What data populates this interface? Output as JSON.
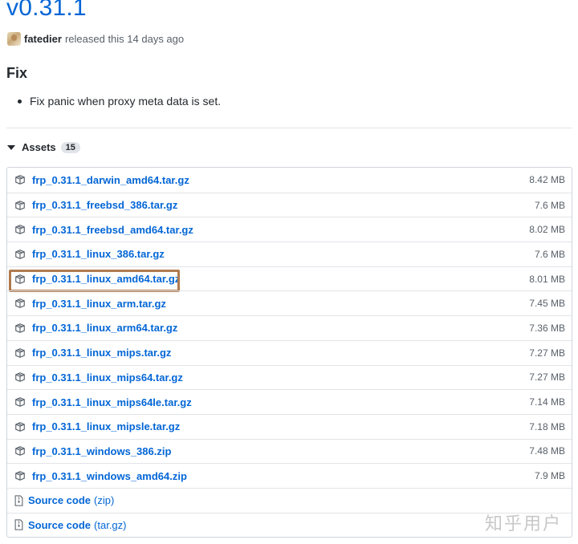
{
  "release": {
    "version": "v0.31.1",
    "author": "fatedier",
    "released_text": "released this 14 days ago"
  },
  "notes": {
    "heading": "Fix",
    "items": [
      "Fix panic when proxy meta data is set."
    ]
  },
  "assets": {
    "label": "Assets",
    "count": "15",
    "files": [
      {
        "name": "frp_0.31.1_darwin_amd64.tar.gz",
        "size": "8.42 MB"
      },
      {
        "name": "frp_0.31.1_freebsd_386.tar.gz",
        "size": "7.6 MB"
      },
      {
        "name": "frp_0.31.1_freebsd_amd64.tar.gz",
        "size": "8.02 MB"
      },
      {
        "name": "frp_0.31.1_linux_386.tar.gz",
        "size": "7.6 MB"
      },
      {
        "name": "frp_0.31.1_linux_amd64.tar.gz",
        "size": "8.01 MB",
        "highlighted": true
      },
      {
        "name": "frp_0.31.1_linux_arm.tar.gz",
        "size": "7.45 MB"
      },
      {
        "name": "frp_0.31.1_linux_arm64.tar.gz",
        "size": "7.36 MB"
      },
      {
        "name": "frp_0.31.1_linux_mips.tar.gz",
        "size": "7.27 MB"
      },
      {
        "name": "frp_0.31.1_linux_mips64.tar.gz",
        "size": "7.27 MB"
      },
      {
        "name": "frp_0.31.1_linux_mips64le.tar.gz",
        "size": "7.14 MB"
      },
      {
        "name": "frp_0.31.1_linux_mipsle.tar.gz",
        "size": "7.18 MB"
      },
      {
        "name": "frp_0.31.1_windows_386.zip",
        "size": "7.48 MB"
      },
      {
        "name": "frp_0.31.1_windows_amd64.zip",
        "size": "7.9 MB"
      }
    ],
    "source": [
      {
        "label": "Source code",
        "format": "(zip)"
      },
      {
        "label": "Source code",
        "format": "(tar.gz)"
      }
    ]
  },
  "watermark": "知乎用户",
  "colors": {
    "link": "#0366d6",
    "highlight_border": "#b07a4f"
  }
}
